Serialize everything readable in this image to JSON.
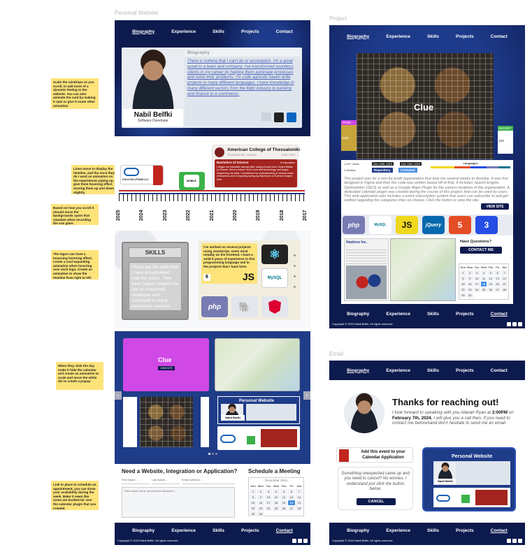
{
  "labels": {
    "personal": "Personal Website",
    "project": "Project",
    "email": "Email"
  },
  "nav": [
    "Biography",
    "Experience",
    "Skills",
    "Projects",
    "Contact"
  ],
  "footer": {
    "copyright": "Copyright © 2024 Nabil Belfki. All rights reserved."
  },
  "notes": {
    "n1": "Scale the raindrops as you scroll, to add more of a dynamic feeling to the website. You can also animate the card by making it spin or give it some other animation",
    "n2": "Lines move to display the timeline, and the once they do I want an animation on the experiences piping up, give them hovering effect moving them up and down slightly.",
    "n3": "Based on how you scroll it should move the backgrounds spots that simulate when recording the sun glare.",
    "n4": "The logos can have a bouncing hovering effect, create a cool expanding animation when hovering over each logo. Create an animation to show the timeline from right to left.",
    "n5": "When they click the day make it hide the calendar and create an animation to scale and move the white div to create a popup.",
    "n6": "Link to place to schedule an appointment, you can show your availability during the week. Make it seem like some are booked lol. Use the calendar plugin that you created."
  },
  "bio": {
    "heading": "Biography",
    "text": "There is nothing that I can't do or accomplish. I'm a great asset to a team and company. I've transformed countless clients in my career by helping them automate processes and solve their problems. I'm code agnostic haven write projects in many different languages. I have knowledge in many different sectors from the flight industry to banking and finance to e-commerce.",
    "name": "Nabil Belfki",
    "role": "Software Developer"
  },
  "timeline": {
    "years": [
      "2025",
      "2024",
      "2023",
      "2022",
      "2021",
      "2020",
      "2019",
      "2018",
      "2017"
    ],
    "school": "American College of Thessaloniki",
    "school_loc": "Thessaloniki, Greece",
    "school_date": "June 2017",
    "degree": "Bachelors of Science",
    "degree_tag": "$ education",
    "degree_text": "I began my education abroad after having moved from United States to Greece. Here is where I fell in love with technology and began sharpening my skills. I broadened my understanding of various areas of Business and Computing during my Bachelors of Science Degree here.",
    "logo1": "COLA SOLUTIONS LLC",
    "logo2": "MOBILE"
  },
  "skills": {
    "title": "SKILLS",
    "text": "These are the skills that I have accumulated over the years. They have helped shaped me into an esteemed developer and contribute to many companies success.",
    "blurb": "I've worked on several projects using JavaScript, some most notably on the frontend. I have a solid 5 years of experience in this programming language and in the projects that I have here.",
    "years": "6",
    "js": "JS",
    "php": "php",
    "mysql": "MySQL"
  },
  "carousel": {
    "clue": "Clue",
    "clue_btn": "VIEW SITE"
  },
  "contact": {
    "title": "Need a Website, Integration or Application?",
    "first": "First Name...",
    "last": "Last Name...",
    "email": "Email Address...",
    "message": "Then reach out to me and let's discuss it...",
    "schedule": "Schedule a Meeting",
    "month": "December 2024"
  },
  "calendar": {
    "days": [
      "Sun",
      "Mon",
      "Tue",
      "Wed",
      "Thu",
      "Fri",
      "Sat"
    ],
    "dates": [
      "1",
      "2",
      "3",
      "4",
      "5",
      "6",
      "7",
      "8",
      "9",
      "10",
      "11",
      "12",
      "13",
      "14",
      "15",
      "16",
      "17",
      "18",
      "19",
      "20",
      "21",
      "22",
      "23",
      "24",
      "25",
      "26",
      "27",
      "28",
      "29",
      "30"
    ]
  },
  "project": {
    "views": "1,247 Views",
    "date1": "Dec 16th, 2022",
    "date2": "Dec 16th, 2022",
    "months": "2 Months",
    "repo": "Repository",
    "container": "Container",
    "languages": "Languages",
    "desc": "This project was for a non-for-profit organization that took me several weeks to develop. It was first designed in Figma and then the code was written based off of that. It includes Search Engine Optimization (SEO) as well as a Google Maps Plugin for the various locations of the organization. A dedicated calendar plugin was created during the course of this project, that can be used by users. This web application also includes a event subscription system that users can subscribe to and get notified regarding the categories they so choose. Click the button to view the site.",
    "view_site": "VIEW SITE",
    "clue": "Clue",
    "tile_php": "php",
    "tile_js": "JS",
    "tile_jq": "jQuery",
    "tile_mysql": "MySQL",
    "hasbro": "Hasbros Inc.",
    "questions": "Have Questions?",
    "contact_me": "CONTACT ME",
    "side_left": "ATION",
    "side_left2": "ONE",
    "side_right": "SECRET",
    "side_right2": "MO"
  },
  "email": {
    "title": "Thanks for reaching out!",
    "body1": "I look forward to speaking with you Alanah Ryan at",
    "time": "2:00PM",
    "on": "on",
    "date": "February 7th, 2024.",
    "body2": "I will give you a call then. If you need to contact me beforehand don't hesitate to send me an email.",
    "add_event": "Add this event to your Calendar Application",
    "cancel_q": "Something unexpected came up and you need to cancel? No worries, I understand just click the button below.",
    "cancel": "CANCEL",
    "preview_title": "Personal Website",
    "preview_name": "Nabil Belfki"
  }
}
